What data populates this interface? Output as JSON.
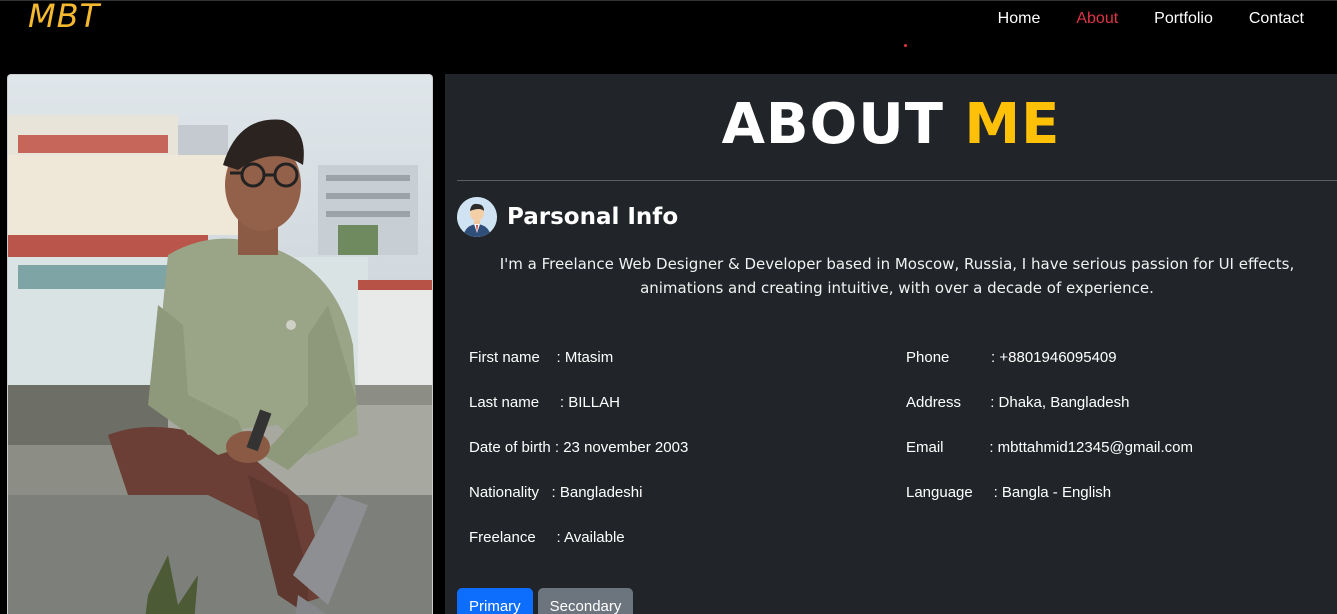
{
  "brand": "MBT",
  "nav": {
    "items": [
      "Home",
      "About",
      "Portfolio",
      "Contact"
    ],
    "active": "About"
  },
  "about": {
    "title": "ABOUT",
    "title_highlight": "ME",
    "section_title": "Parsonal Info",
    "bio": "I'm a Freelance Web Designer & Developer based in Moscow, Russia, I have serious passion for UI effects, animations and creating intuitive, with over a decade of experience.",
    "left_rows": [
      "First name    : Mtasim",
      "Last name     : BILLAH",
      "Date of birth : 23 november 2003",
      "Nationality   : Bangladeshi",
      "Freelance     : Available"
    ],
    "right_rows": [
      "Phone          : +8801946095409",
      "Address       : Dhaka, Bangladesh",
      "Email           : mbttahmid12345@gmail.com",
      "Language     : Bangla - English"
    ],
    "buttons": {
      "primary": "Primary",
      "secondary": "Secondary"
    }
  },
  "colors": {
    "brand": "#f5b82e",
    "active_nav": "#dc3545",
    "highlight": "#ffc107",
    "panel_bg": "#212529",
    "primary": "#0d6efd",
    "secondary": "#6c757d"
  },
  "icons": {
    "avatar": "businessman-avatar-icon"
  }
}
